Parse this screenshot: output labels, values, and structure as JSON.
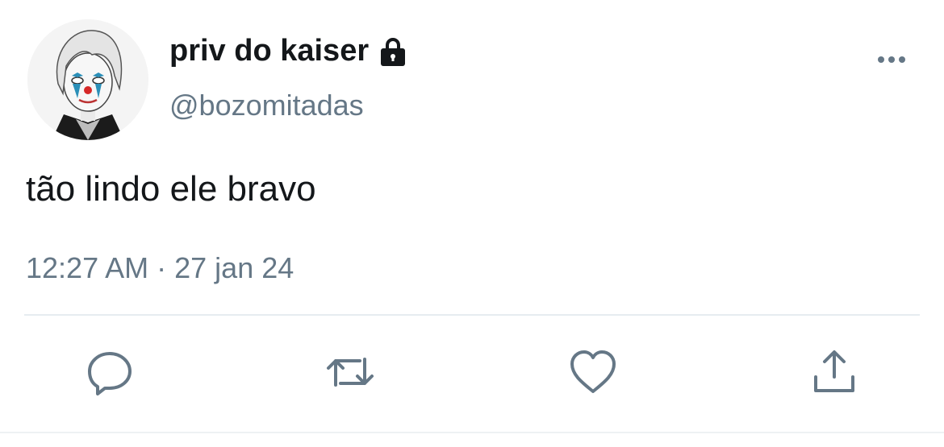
{
  "tweet": {
    "display_name": "priv do kaiser",
    "handle": "@bozomitadas",
    "text": "tão lindo ele bravo",
    "time": "12:27 AM",
    "separator": "·",
    "date": "27 jan 24"
  },
  "icons": {
    "lock": "lock-icon",
    "more": "more-icon",
    "reply": "reply-icon",
    "retweet": "retweet-icon",
    "like": "heart-icon",
    "share": "share-icon"
  },
  "colors": {
    "text_primary": "#14171a",
    "text_secondary": "#657786",
    "divider": "#e6ecf0"
  }
}
